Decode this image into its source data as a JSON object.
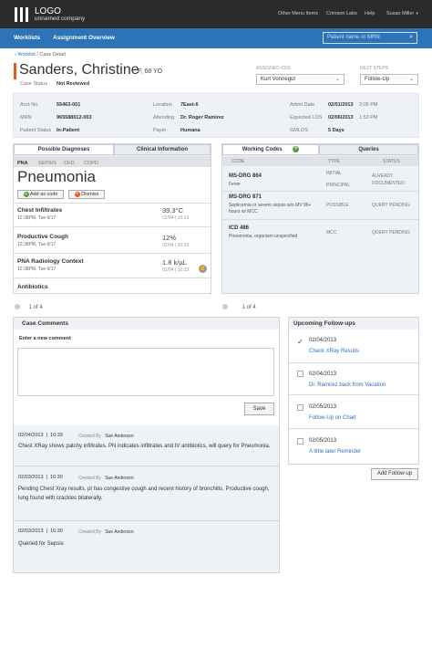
{
  "topbar": {
    "logo": "LOGO",
    "company": "unnamed company",
    "links": [
      "Other Menu Items",
      "Crimson Labs",
      "Help",
      "Susan Miller"
    ]
  },
  "nav": {
    "worklists": "Worklists",
    "assignment": "Assignment Overview",
    "search_placeholder": "Patient name or MRN"
  },
  "breadcrumb": {
    "back": "Worklist",
    "separator": "/",
    "current": "Case Detail"
  },
  "patient": {
    "name": "Sanders, Christine",
    "info": "F, 68 YO",
    "case_status_label": "Case Status",
    "case_status": "Not Reviewed",
    "assigned_cds_label": "ASSIGNED CDS",
    "assigned_cds": "Kurt Vonnegut",
    "next_steps_label": "NEXT STEPS",
    "next_steps": "Follow-Up"
  },
  "info": {
    "acct_no_label": "Acct No.",
    "acct_no": "55463-001",
    "mrn_label": "MRN",
    "mrn": "965588012-003",
    "patient_status_label": "Patient Status",
    "patient_status": "In-Patient",
    "location_label": "Location",
    "location": "7East-6",
    "attending_label": "Attending",
    "attending": "Dr. Roger Ramirez",
    "payer_label": "Payer",
    "payer": "Humana",
    "admit_label": "Admit Date",
    "admit": "02/01/2013",
    "admit_time": "2:05 PM",
    "los_label": "Expected LOS",
    "los": "02/06/2013",
    "los_time": "1:53 PM",
    "gmlos_label": "GMLOS",
    "gmlos": "5 Days"
  },
  "diagnoses": {
    "tab_possible": "Possible Diagnoses",
    "tab_clinical": "Clinical Information",
    "subtabs": [
      "PNA",
      "SEPSIS",
      "CKD",
      "COPD"
    ],
    "title": "Pneumonia",
    "add_code": "Add as code",
    "dismiss": "Dismiss",
    "rows": [
      {
        "title": "Chest Infiltrates",
        "sub": "12:38PM, Tue 6/17",
        "value": "39.3°C",
        "date": "02/04",
        "time": "10:33"
      },
      {
        "title": "Productive Cough",
        "sub": "12:38PM, Tue 6/17",
        "value": "12%",
        "date": "02/04",
        "time": "10:33"
      },
      {
        "title": "PNA Radiology Context",
        "sub": "12:38PM, Tue 6/17",
        "value": "1.8 k/µL",
        "date": "02/04",
        "time": "10:33"
      },
      {
        "title": "Antibiotics"
      }
    ],
    "pager": "1 of 4"
  },
  "codes": {
    "tab_working": "Working Codes",
    "tab_queries": "Queries",
    "col_code": "CODE",
    "col_type": "TYPE",
    "col_status": "STATUS",
    "rows": [
      {
        "code": "MS-DRG 864",
        "desc": "Fever",
        "type1": "INITIAL",
        "type2": "PRINCIPAL",
        "status1": "ALREADY",
        "status2": "DOCUMENTED"
      },
      {
        "code": "MS-DRG 871",
        "desc": "Septicemia or severe sepsis w/o MV 96+ hours w/ MCC",
        "type1": "POSSIBLE",
        "status1": "QUERY PENDING"
      },
      {
        "code": "ICD 486",
        "desc": "Pneumonia, organism unspecified",
        "type1": "MCC",
        "status1": "QUERY PENDING"
      }
    ],
    "pager": "1 of 4"
  },
  "comments": {
    "title": "Case Comments",
    "enter_label": "Enter a new comment",
    "save": "Save",
    "items": [
      {
        "date": "02/04/2013",
        "time": "10:33",
        "by_label": "Created By",
        "by": "Sue Anderson",
        "text": "Chest XRay shows patchy infiltrates. PN indicates infiltrates and IV antibiotics, will query for Pneumonia."
      },
      {
        "date": "02/03/2013",
        "time": "16:30",
        "by_label": "Created By",
        "by": "Sue Anderson",
        "text": "Pending Chest Xray results, pt has congestive cough and recent history of bronchitis. Productive cough, lung found with crackles bilaterally."
      },
      {
        "date": "02/03/2013",
        "time": "16:30",
        "by_label": "Created By",
        "by": "Sue Anderson",
        "text": "Queried for Sepsis"
      }
    ]
  },
  "followups": {
    "title": "Upcoming Follow-ups",
    "items": [
      {
        "date": "02/04/2013",
        "text": "Check XRay Results",
        "checked": true
      },
      {
        "date": "02/04/2013",
        "text": "Dr. Ramirez back from Vacation",
        "checked": false
      },
      {
        "date": "02/05/2013",
        "text": "Follow-Up on Chart",
        "checked": false
      },
      {
        "date": "02/05/2013",
        "text": "A little later Reminder",
        "checked": false
      }
    ],
    "add": "Add Follow-up"
  },
  "colors": {
    "nav": "#2d73b8",
    "accent": "#e05a1c",
    "topbar": "#2b2b2b",
    "panel": "#eef1f5"
  }
}
